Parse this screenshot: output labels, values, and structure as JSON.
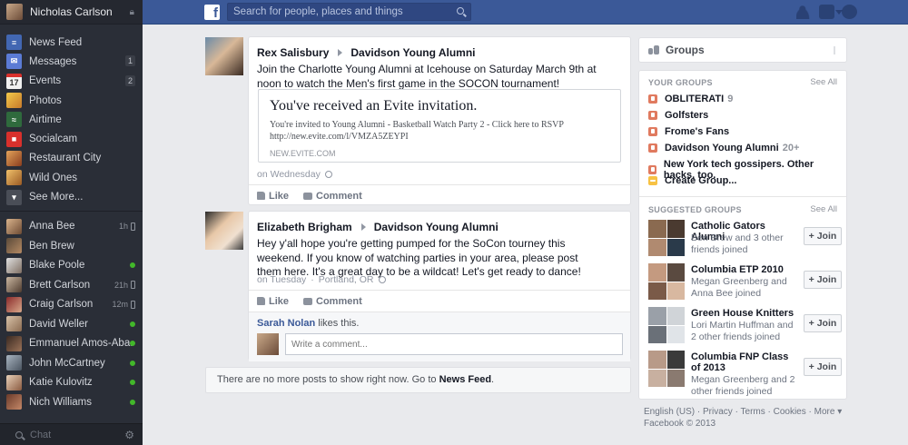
{
  "sidebar": {
    "user_name": "Nicholas Carlson",
    "nav": [
      {
        "label": "News Feed",
        "count": "",
        "icon": "news-feed-icon",
        "color": "#4267b2"
      },
      {
        "label": "Messages",
        "count": "1",
        "icon": "messages-icon",
        "color": "#5b7bd5"
      },
      {
        "label": "Events",
        "count": "2",
        "icon": "events-icon",
        "color": "#8c929d"
      },
      {
        "label": "Photos",
        "count": "",
        "icon": "photos-icon",
        "color": "#e4b343"
      },
      {
        "label": "Airtime",
        "count": "",
        "icon": "airtime-icon",
        "color": "#3a7a4a"
      },
      {
        "label": "Socialcam",
        "count": "",
        "icon": "socialcam-icon",
        "color": "#d8302c"
      },
      {
        "label": "Restaurant City",
        "count": "",
        "icon": "restaurant-city-icon",
        "color": "#b25b2c"
      },
      {
        "label": "Wild Ones",
        "count": "",
        "icon": "wild-ones-icon",
        "color": "#c78a3a"
      },
      {
        "label": "See More...",
        "count": "",
        "icon": "chevron-down-icon",
        "color": "#5a5e67"
      }
    ],
    "friends": [
      {
        "name": "Anna Bee",
        "status": "1h",
        "mode": "mobile"
      },
      {
        "name": "Ben Brew",
        "status": "",
        "mode": "none"
      },
      {
        "name": "Blake Poole",
        "status": "",
        "mode": "online"
      },
      {
        "name": "Brett Carlson",
        "status": "21h",
        "mode": "mobile"
      },
      {
        "name": "Craig Carlson",
        "status": "12m",
        "mode": "mobile"
      },
      {
        "name": "David Weller",
        "status": "",
        "mode": "online"
      },
      {
        "name": "Emmanuel Amos-Aba...",
        "status": "",
        "mode": "online"
      },
      {
        "name": "John McCartney",
        "status": "",
        "mode": "online"
      },
      {
        "name": "Katie Kulovitz",
        "status": "",
        "mode": "online"
      },
      {
        "name": "Nich Williams",
        "status": "",
        "mode": "online"
      }
    ],
    "chat_placeholder": "Chat"
  },
  "topbar": {
    "search_placeholder": "Search for people, places and things",
    "brand_color": "#3b5998"
  },
  "posts": [
    {
      "author": "Rex Salisbury",
      "target": "Davidson Young Alumni",
      "text": "Join the Charlotte Young Alumni at Icehouse on Saturday March 9th at noon to watch the Men's first game in the SOCON tournament!",
      "attachment": {
        "title": "You've received an Evite invitation.",
        "desc_line1": "You're invited to Young Alumni - Basketball Watch Party 2 - Click here to RSVP",
        "desc_line2": "http://new.evite.com/l/VMZA5ZEYPI",
        "domain": "NEW.EVITE.COM"
      },
      "time": "on Wednesday",
      "like_label": "Like",
      "comment_label": "Comment"
    },
    {
      "author": "Elizabeth Brigham",
      "target": "Davidson Young Alumni",
      "text": "Hey y'all hope you're getting pumped for the SoCon tourney this weekend. If you know of watching parties in your area, please post them here. It's a great day to be a wildcat! Let's get ready to dance!",
      "time": "on Tuesday",
      "location": "Portland, OR",
      "like_label": "Like",
      "comment_label": "Comment",
      "liker": "Sarah Nolan",
      "likes_suffix": "likes this.",
      "comment_placeholder": "Write a comment..."
    }
  ],
  "no_more": {
    "text": "There are no more posts to show right now. Go to",
    "link": "News Feed",
    "end": "."
  },
  "groups": {
    "header": "Groups",
    "your_title": "YOUR GROUPS",
    "see_all": "See All",
    "your": [
      {
        "name": "OBLITERATI",
        "count": "9"
      },
      {
        "name": "Golfsters",
        "count": ""
      },
      {
        "name": "Frome's Fans",
        "count": ""
      },
      {
        "name": "Davidson Young Alumni",
        "count": "20+"
      },
      {
        "name": "New York tech gossipers. Other hacks, too.",
        "count": ""
      },
      {
        "name": "Create Group...",
        "count": ""
      }
    ],
    "suggested_title": "SUGGESTED GROUPS",
    "join_label": "+ Join",
    "suggested": [
      {
        "name": "Catholic Gators Alumni",
        "sub": "Ben Brew and 3 other friends joined"
      },
      {
        "name": "Columbia ETP 2010",
        "sub": "Megan Greenberg and Anna Bee joined"
      },
      {
        "name": "Green House Knitters",
        "sub": "Lori Martin Huffman and 2 other friends joined"
      },
      {
        "name": "Columbia FNP Class of 2013",
        "sub": "Megan Greenberg and 2 other friends joined"
      }
    ]
  },
  "footer": {
    "line1": "English (US) · Privacy · Terms · Cookies · More ▾",
    "line2": "Facebook © 2013"
  }
}
